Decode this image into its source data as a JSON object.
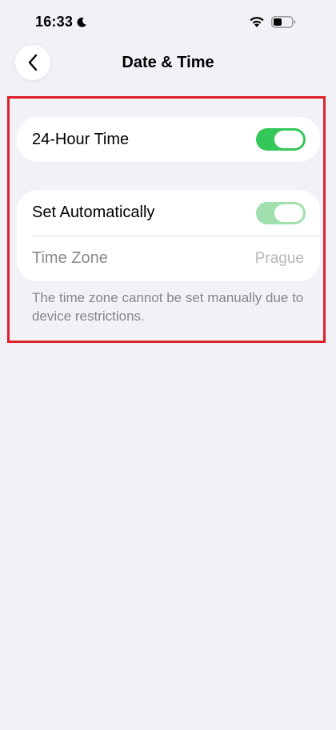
{
  "status_bar": {
    "time": "16:33",
    "icons": [
      "moon-icon",
      "wifi-icon",
      "battery-icon"
    ]
  },
  "nav": {
    "title": "Date & Time",
    "back_icon": "chevron-left-icon"
  },
  "settings": {
    "hour24": {
      "label": "24-Hour Time",
      "enabled": true
    },
    "set_automatically": {
      "label": "Set Automatically",
      "enabled": true,
      "locked": true
    },
    "time_zone": {
      "label": "Time Zone",
      "value": "Prague"
    },
    "footnote": "The time zone cannot be set manually due to device restrictions."
  },
  "colors": {
    "background": "#f2f1f6",
    "toggle_on": "#34c759",
    "toggle_disabled": "#9fe0ad",
    "highlight": "#e0202a"
  }
}
